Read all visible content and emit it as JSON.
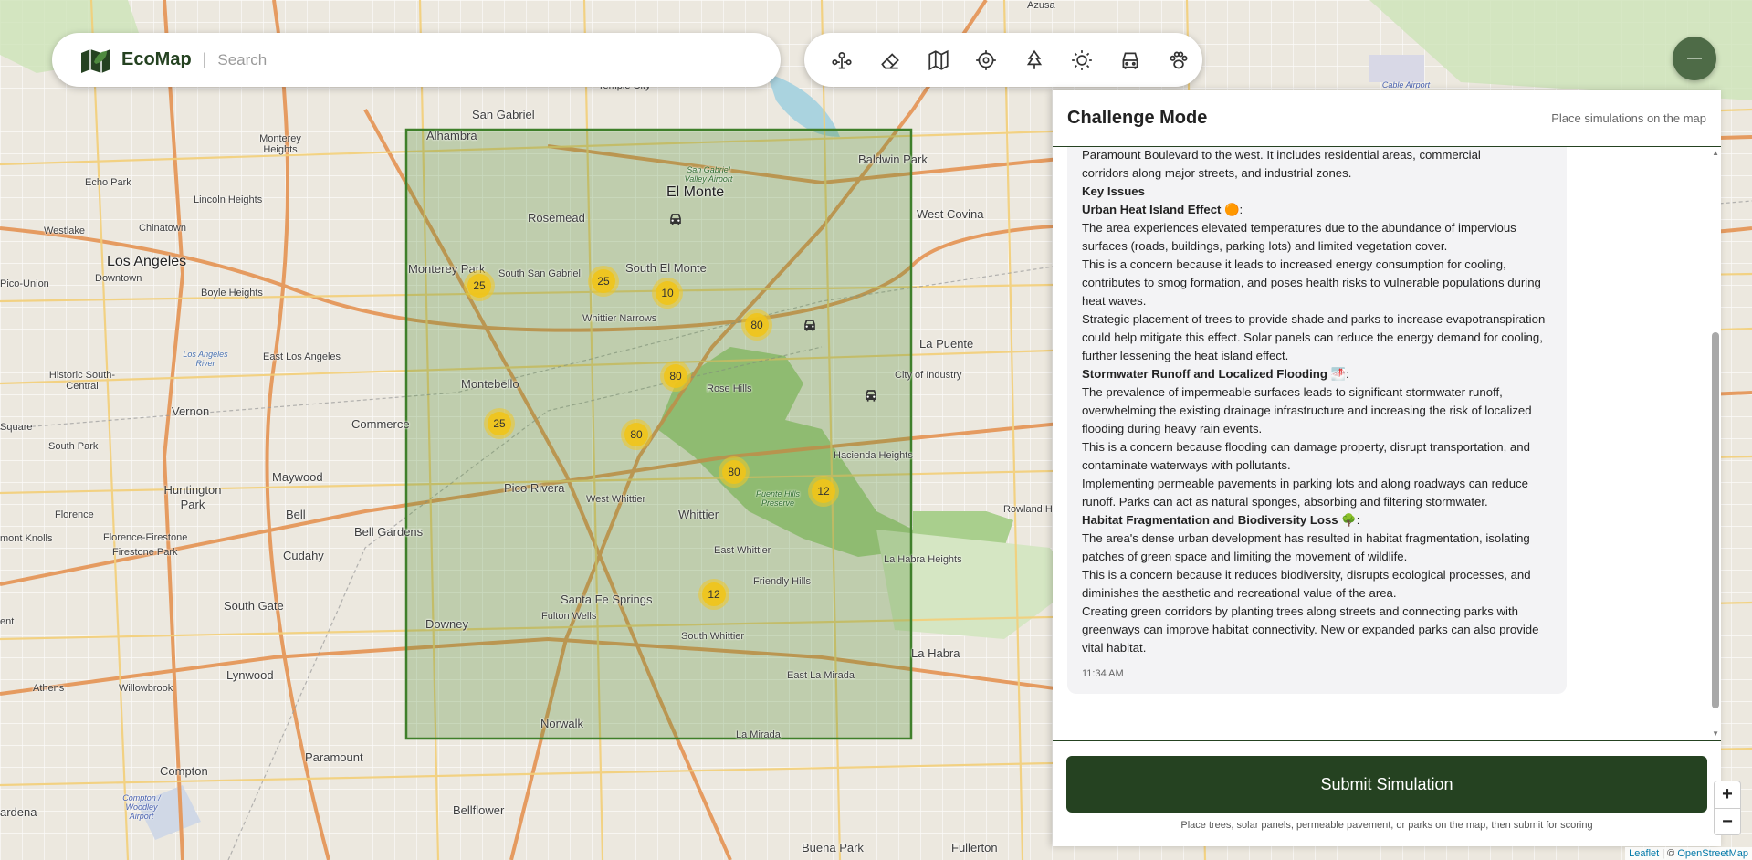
{
  "app": {
    "name": "EcoMap",
    "separator": "|"
  },
  "search": {
    "placeholder": "Search",
    "value": ""
  },
  "toolbar": {
    "tools": [
      {
        "icon": "sprout-network-icon"
      },
      {
        "icon": "eraser-icon"
      },
      {
        "icon": "map-icon"
      },
      {
        "icon": "target-icon"
      },
      {
        "icon": "tree-icon"
      },
      {
        "icon": "sun-icon"
      },
      {
        "icon": "car-icon"
      },
      {
        "icon": "paw-icon"
      }
    ],
    "menu_symbol": "–"
  },
  "map": {
    "places": [
      {
        "label": "Azusa"
      },
      {
        "label": "San Gabriel"
      },
      {
        "label": "Temple City"
      },
      {
        "label": "Alhambra"
      },
      {
        "label": "Monterey Heights"
      },
      {
        "label": "Lincoln Heights"
      },
      {
        "label": "Echo Park"
      },
      {
        "label": "Westlake"
      },
      {
        "label": "Chinatown"
      },
      {
        "label": "Los Angeles"
      },
      {
        "label": "Downtown"
      },
      {
        "label": "Pico-Union"
      },
      {
        "label": "Boyle Heights"
      },
      {
        "label": "Monterey Park"
      },
      {
        "label": "South San Gabriel"
      },
      {
        "label": "Rosemead"
      },
      {
        "label": "El Monte"
      },
      {
        "label": "South El Monte"
      },
      {
        "label": "Baldwin Park"
      },
      {
        "label": "West Covina"
      },
      {
        "label": "Whittier Narrows"
      },
      {
        "label": "East Los Angeles"
      },
      {
        "label": "Historic South-Central"
      },
      {
        "label": "Vernon"
      },
      {
        "label": "Montebello"
      },
      {
        "label": "Commerce"
      },
      {
        "label": "Rose Hills"
      },
      {
        "label": "La Puente"
      },
      {
        "label": "City of Industry"
      },
      {
        "label": "Hacienda Heights"
      },
      {
        "label": "Square"
      },
      {
        "label": "South Park"
      },
      {
        "label": "Huntington Park"
      },
      {
        "label": "Maywood"
      },
      {
        "label": "Pico Rivera"
      },
      {
        "label": "West Whittier"
      },
      {
        "label": "Whittier"
      },
      {
        "label": "Florence"
      },
      {
        "label": "Bell"
      },
      {
        "label": "Florence-Firestone"
      },
      {
        "label": "Firestone Park"
      },
      {
        "label": "Bell Gardens"
      },
      {
        "label": "Cudahy"
      },
      {
        "label": "mont Knolls"
      },
      {
        "label": "East Whittier"
      },
      {
        "label": "La Habra Heights"
      },
      {
        "label": "Rowland H"
      },
      {
        "label": "Friendly Hills"
      },
      {
        "label": "Santa Fe Springs"
      },
      {
        "label": "Fulton Wells"
      },
      {
        "label": "South Gate"
      },
      {
        "label": "Downey"
      },
      {
        "label": "South Whittier"
      },
      {
        "label": "La Habra"
      },
      {
        "label": "Lynwood"
      },
      {
        "label": "Willowbrook"
      },
      {
        "label": "Athens"
      },
      {
        "label": "East La Mirada"
      },
      {
        "label": "Norwalk"
      },
      {
        "label": "La Mirada"
      },
      {
        "label": "Paramount"
      },
      {
        "label": "Compton"
      },
      {
        "label": "Bellflower"
      },
      {
        "label": "ardena"
      },
      {
        "label": "Buena Park"
      },
      {
        "label": "Fullerton"
      },
      {
        "label": "ent"
      }
    ],
    "parks": [
      {
        "label": "San Gabriel Valley Airport"
      },
      {
        "label": "Los Angeles River"
      },
      {
        "label": "Puente Hills Preserve"
      },
      {
        "label": "Compton / Woodley Airport"
      },
      {
        "label": "Cable Airport"
      }
    ],
    "clusters": [
      {
        "count": "25"
      },
      {
        "count": "25"
      },
      {
        "count": "10"
      },
      {
        "count": "80"
      },
      {
        "count": "80"
      },
      {
        "count": "25"
      },
      {
        "count": "80"
      },
      {
        "count": "80"
      },
      {
        "count": "12"
      },
      {
        "count": "12"
      }
    ],
    "vehicle_markers": 3,
    "colors": {
      "selection_fill": "#4a8a2a",
      "selection_stroke": "#3f7f2a",
      "cluster": "#f0c419"
    }
  },
  "panel": {
    "title": "Challenge Mode",
    "hint": "Place simulations on the map",
    "message": {
      "intro_cut": "Paramount Boulevard to the west. It includes residential areas, commercial",
      "intro_tail": "corridors along major streets, and industrial zones.",
      "key_issues_heading": "Key Issues",
      "issues": [
        {
          "title": "Urban Heat Island Effect",
          "emoji": "🟠",
          "paragraphs": [
            "The area experiences elevated temperatures due to the abundance of impervious surfaces (roads, buildings, parking lots) and limited vegetation cover.",
            "This is a concern because it leads to increased energy consumption for cooling, contributes to smog formation, and poses health risks to vulnerable populations during heat waves.",
            "Strategic placement of trees to provide shade and parks to increase evapotranspiration could help mitigate this effect. Solar panels can reduce the energy demand for cooling, further lessening the heat island effect."
          ]
        },
        {
          "title": "Stormwater Runoff and Localized Flooding",
          "emoji": "🌁",
          "paragraphs": [
            "The prevalence of impermeable surfaces leads to significant stormwater runoff, overwhelming the existing drainage infrastructure and increasing the risk of localized flooding during heavy rain events.",
            "This is a concern because flooding can damage property, disrupt transportation, and contaminate waterways with pollutants.",
            "Implementing permeable pavements in parking lots and along roadways can reduce runoff. Parks can act as natural sponges, absorbing and filtering stormwater."
          ]
        },
        {
          "title": "Habitat Fragmentation and Biodiversity Loss",
          "emoji": "🌳",
          "paragraphs": [
            "The area's dense urban development has resulted in habitat fragmentation, isolating patches of green space and limiting the movement of wildlife.",
            "This is a concern because it reduces biodiversity, disrupts ecological processes, and diminishes the aesthetic and recreational value of the area.",
            "Creating green corridors by planting trees along streets and connecting parks with greenways can improve habitat connectivity. New or expanded parks can also provide vital habitat."
          ]
        }
      ],
      "time": "11:34 AM"
    },
    "submit_label": "Submit Simulation",
    "footer_note": "Place trees, solar panels, permeable pavement, or parks on the map, then submit for scoring"
  },
  "zoom": {
    "in": "+",
    "out": "−"
  },
  "attribution": {
    "leaflet": "Leaflet",
    "sep": " | © ",
    "osm": "OpenStreetMap"
  }
}
